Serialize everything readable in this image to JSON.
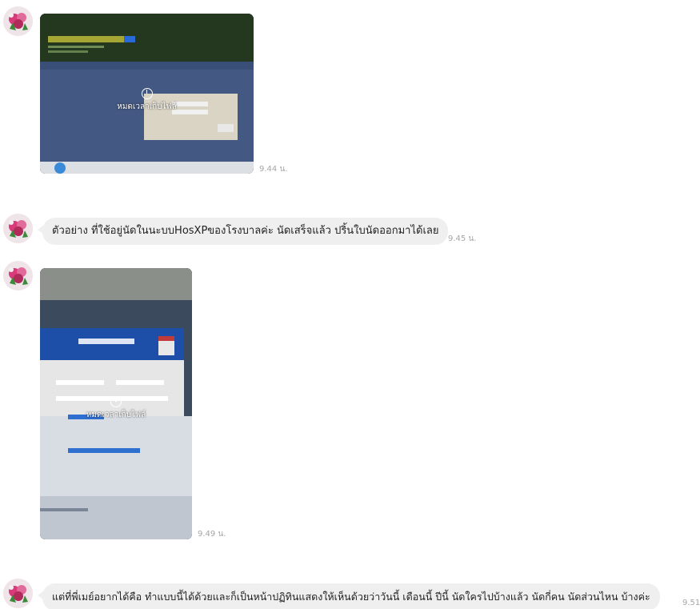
{
  "messages": [
    {
      "type": "image",
      "overlay_text": "หมดเวลาเก็บไฟล์",
      "time": "9.44 น."
    },
    {
      "type": "text",
      "text": "ตัวอย่าง ที่ใช้อยู่นัดในนะบบHosXPของโรงบาลค่ะ นัดเสร็จแล้ว ปริ้นใบนัดออกมาได้เลย",
      "time": "9.45 น."
    },
    {
      "type": "image",
      "overlay_text": "หมดเวลาเก็บไฟล์",
      "time": "9.49 น."
    },
    {
      "type": "text",
      "text": "แต่ที่พี่เมย์อยากได้คือ ทำแบบนี้ได้ด้วยและก็เป็นหน้าปฏิทินแสดงให้เห็นด้วยว่าวันนี้ เดือนนี้ ปีนี้ นัดใครไปบ้างแล้ว นัดกี่คน นัดส่วนไหน บ้างค่ะ",
      "time": "9.51"
    }
  ],
  "colors": {
    "bubble_bg": "#efefef",
    "time_text": "#a6a6a6",
    "background": "#ffffff"
  }
}
